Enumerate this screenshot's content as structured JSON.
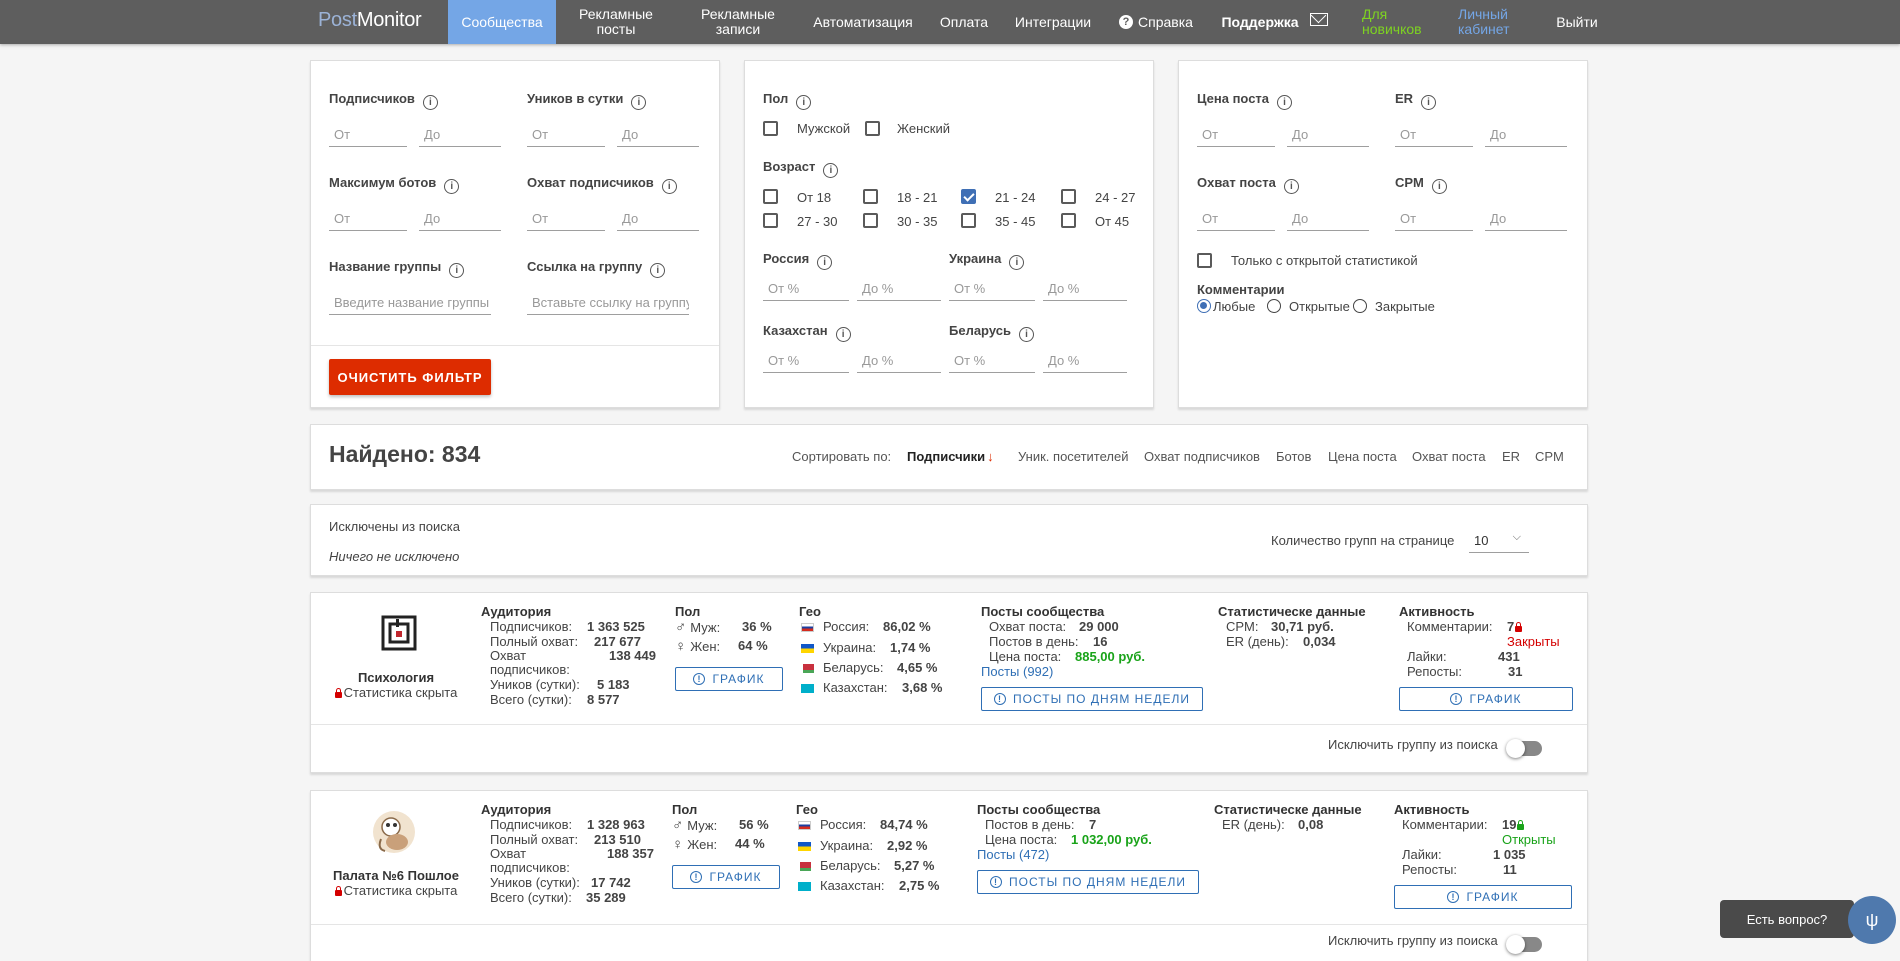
{
  "nav": {
    "logo_post": "Post",
    "logo_monitor": "Monitor",
    "items": [
      {
        "label": "Сообщества"
      },
      {
        "label": "Рекламные\nпосты"
      },
      {
        "label": "Рекламные\nзаписи"
      },
      {
        "label": "Автоматизация"
      },
      {
        "label": "Оплата"
      },
      {
        "label": "Интеграции"
      },
      {
        "label": "Справка"
      },
      {
        "label": "Поддержка"
      },
      {
        "label": "Для\nновичков"
      },
      {
        "label": "Личный\nкабинет"
      },
      {
        "label": "Выйти"
      }
    ]
  },
  "filters1": {
    "subscribers": "Подписчиков",
    "uniques": "Уников в сутки",
    "max_bots": "Максимум ботов",
    "reach_subs": "Охват подписчиков",
    "group_name": "Название группы",
    "group_link": "Ссылка на группу",
    "from": "От",
    "to": "До",
    "group_name_ph": "Введите название группы",
    "group_link_ph": "Вставьте ссылку на группу",
    "clear": "ОЧИСТИТЬ ФИЛЬТР"
  },
  "filters2": {
    "gender": "Пол",
    "male": "Мужской",
    "female": "Женский",
    "age": "Возраст",
    "ages": [
      "От 18",
      "18 - 21",
      "21 - 24",
      "24 - 27",
      "27 - 30",
      "30 - 35",
      "35 - 45",
      "От 45"
    ],
    "russia": "Россия",
    "ukraine": "Украина",
    "kazakhstan": "Казахстан",
    "belarus": "Беларусь",
    "from_pct": "От %",
    "to_pct": "До %"
  },
  "filters3": {
    "post_price": "Цена поста",
    "er": "ER",
    "post_reach": "Охват поста",
    "cpm": "CPM",
    "from": "От",
    "to": "До",
    "open_stats_only": "Только с открытой статистикой",
    "comments": "Комментарии",
    "any": "Любые",
    "open": "Открытые",
    "closed": "Закрытые"
  },
  "results": {
    "found_label": "Найдено: 834",
    "sort_by": "Сортировать по:",
    "sort_items": [
      "Подписчики",
      "Уник. посетителей",
      "Охват подписчиков",
      "Ботов",
      "Цена поста",
      "Охват поста",
      "ER",
      "CPM"
    ],
    "sort_arrow": "↓"
  },
  "excluded": {
    "title": "Исключены из поиска",
    "none": "Ничего не исключено",
    "per_page_label": "Количество групп на странице",
    "per_page_value": "10"
  },
  "labels": {
    "audience": "Аудитория",
    "subscribers": "Подписчиков:",
    "full_reach": "Полный охват:",
    "reach_subs_1": "Охват",
    "reach_subs_2": "подписчиков:",
    "uniques_day": "Уников (сутки):",
    "total_day": "Всего (сутки):",
    "gender": "Пол",
    "male": "Муж:",
    "female": "Жен:",
    "chart_btn": "ГРАФИК",
    "geo": "Гео",
    "russia": "Россия:",
    "ukraine": "Украина:",
    "belarus": "Беларусь:",
    "kazakhstan": "Казахстан:",
    "posts_title": "Посты сообщества",
    "post_reach": "Охват поста:",
    "posts_per_day": "Постов в день:",
    "post_price": "Цена поста:",
    "weekday_btn": "ПОСТЫ ПО ДНЯМ НЕДЕЛИ",
    "stats_title": "Статистическе данные",
    "cpm": "CPM:",
    "er_day": "ER (день):",
    "activity": "Активность",
    "comments": "Комментарии:",
    "likes": "Лайки:",
    "reposts": "Репосты:",
    "exclude": "Исключить группу из поиска",
    "stats_hidden": "Статистика скрыта"
  },
  "groups": [
    {
      "name": "Психология",
      "subscribers": "1 363 525",
      "full_reach": "217 677",
      "reach_subs": "138 449",
      "uniques": "5 183",
      "total": "8 577",
      "male": "36 %",
      "female": "64 %",
      "russia": "86,02 %",
      "ukraine": "1,74 %",
      "belarus": "4,65 %",
      "kazakhstan": "3,68 %",
      "post_reach": "29 000",
      "posts_per_day": "16",
      "post_price": "885,00  руб.",
      "posts_link": "Посты (992)",
      "cpm": "30,71  руб.",
      "er_day": "0,034",
      "comments": "7",
      "comments_status": "Закрыты",
      "likes": "431",
      "reposts": "31"
    },
    {
      "name": "Палата №6 Пошлое",
      "subscribers": "1 328 963",
      "full_reach": "213 510",
      "reach_subs": "188 357",
      "uniques": "17 742",
      "total": "35 289",
      "male": "56 %",
      "female": "44 %",
      "russia": "84,74 %",
      "ukraine": "2,92 %",
      "belarus": "5,27 %",
      "kazakhstan": "2,75 %",
      "posts_per_day": "7",
      "post_price": "1 032,00  руб.",
      "posts_link": "Посты (472)",
      "er_day": "0,08",
      "comments": "19",
      "comments_status": "Открыты",
      "likes": "1 035",
      "reposts": "11"
    }
  ],
  "chat": {
    "question": "Есть вопрос?"
  }
}
